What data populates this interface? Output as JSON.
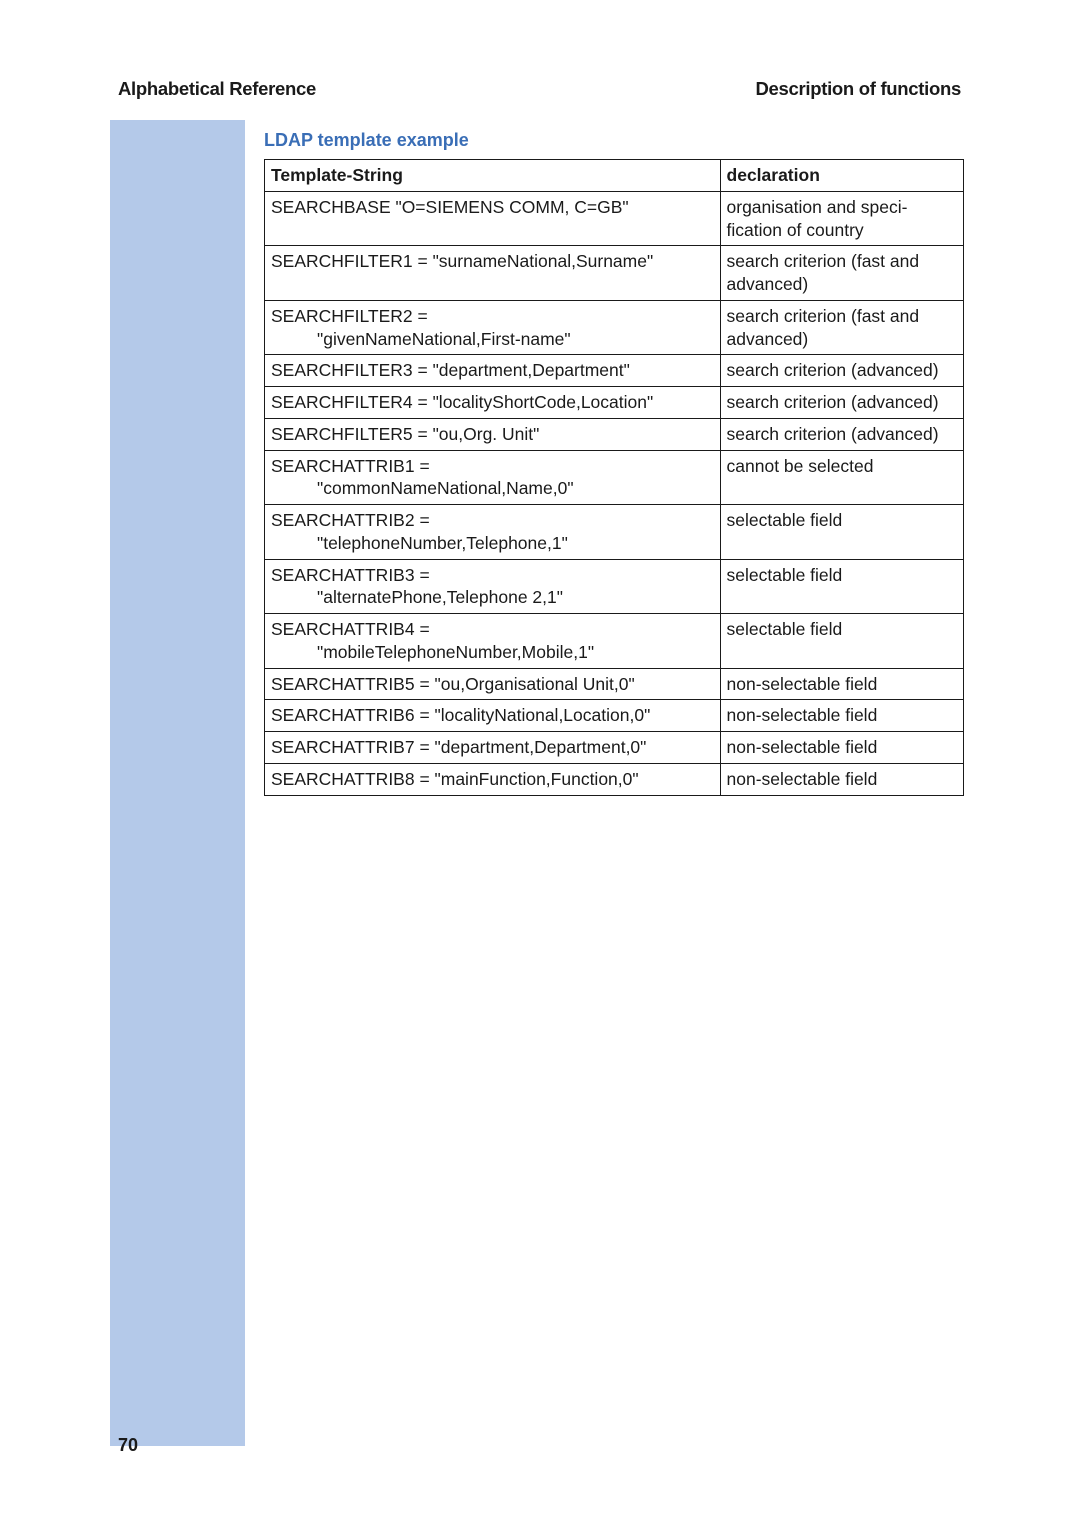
{
  "header": {
    "left": "Alphabetical Reference",
    "right": "Description of functions"
  },
  "section_heading": "LDAP template example",
  "table": {
    "headers": [
      "Template-String",
      "declaration"
    ],
    "rows": [
      {
        "col1": "SEARCHBASE \"O=SIEMENS COMM, C=GB\"",
        "col2": "organisation and speci-fication of country"
      },
      {
        "col1": "SEARCHFILTER1 = \"surnameNational,Surname\"",
        "col2": "search criterion (fast and advanced)"
      },
      {
        "col1_line1": "SEARCHFILTER2 =",
        "col1_line2": "\"givenNameNational,First-name\"",
        "col2": "search criterion (fast and advanced)"
      },
      {
        "col1": "SEARCHFILTER3 = \"department,Department\"",
        "col2": "search criterion (advanced)"
      },
      {
        "col1": "SEARCHFILTER4 = \"localityShortCode,Location\"",
        "col2": "search criterion (advanced)"
      },
      {
        "col1": "SEARCHFILTER5 = \"ou,Org. Unit\"",
        "col2": "search criterion (advanced)"
      },
      {
        "col1_line1": "SEARCHATTRIB1 =",
        "col1_line2": "\"commonNameNational,Name,0\"",
        "col2": "cannot be selected"
      },
      {
        "col1_line1": "SEARCHATTRIB2 =",
        "col1_line2": "\"telephoneNumber,Telephone,1\"",
        "col2": "selectable field"
      },
      {
        "col1_line1": "SEARCHATTRIB3 =",
        "col1_line2": "\"alternatePhone,Telephone 2,1\"",
        "col2": "selectable field"
      },
      {
        "col1_line1": "SEARCHATTRIB4 =",
        "col1_line2": "\"mobileTelephoneNumber,Mobile,1\"",
        "col2": "selectable field"
      },
      {
        "col1": "SEARCHATTRIB5 = \"ou,Organisational Unit,0\"",
        "col2": "non-selectable field"
      },
      {
        "col1": "SEARCHATTRIB6 = \"localityNational,Location,0\"",
        "col2": "non-selectable field"
      },
      {
        "col1": "SEARCHATTRIB7 = \"department,Department,0\"",
        "col2": "non-selectable field"
      },
      {
        "col1": "SEARCHATTRIB8 = \"mainFunction,Function,0\"",
        "col2": "non-selectable field"
      }
    ]
  },
  "page_number": "70"
}
